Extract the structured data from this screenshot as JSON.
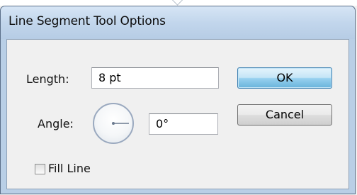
{
  "window": {
    "title": "Line Segment Tool Options"
  },
  "length": {
    "label": "Length:",
    "value": "8 pt"
  },
  "angle": {
    "label": "Angle:",
    "value": "0°",
    "dial_value_degrees": 0
  },
  "buttons": {
    "ok": "OK",
    "cancel": "Cancel"
  },
  "fill_line": {
    "label": "Fill Line",
    "checked": false
  },
  "colors": {
    "default_button": "#98d1ef",
    "titlebar": "#c2d6ec"
  }
}
